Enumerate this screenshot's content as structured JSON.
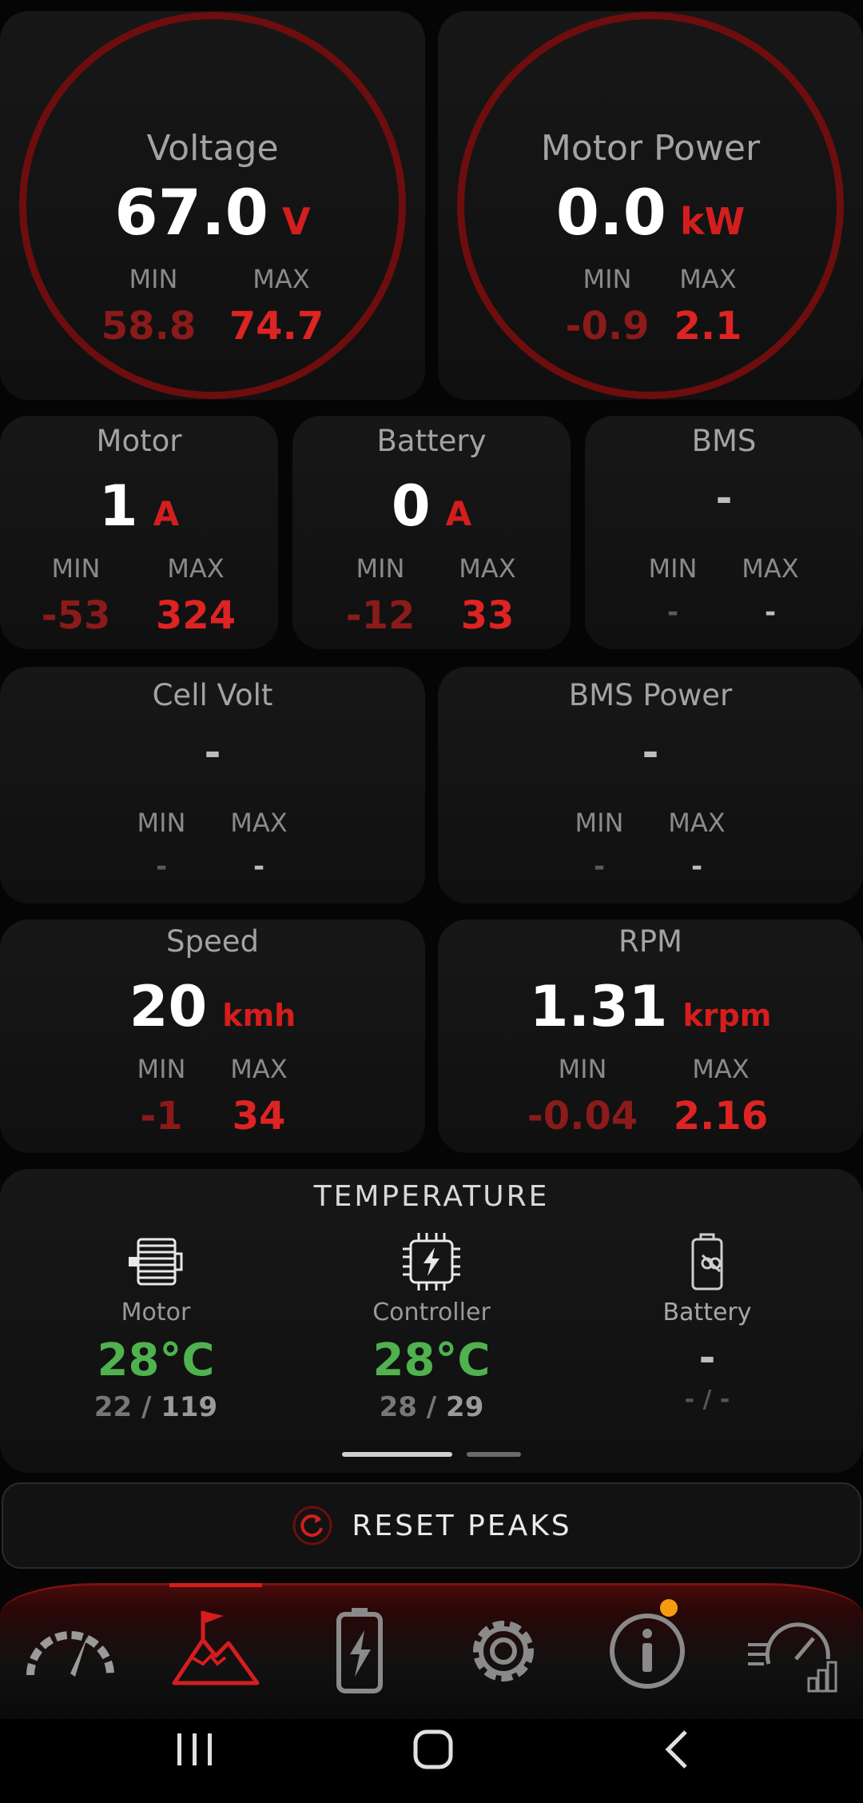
{
  "voltage": {
    "title": "Voltage",
    "value": "67.0",
    "unit": "V",
    "min_label": "MIN",
    "max_label": "MAX",
    "min": "58.8",
    "max": "74.7"
  },
  "motor_power": {
    "title": "Motor Power",
    "value": "0.0",
    "unit": "kW",
    "min_label": "MIN",
    "max_label": "MAX",
    "min": "-0.9",
    "max": "2.1"
  },
  "motor": {
    "title": "Motor",
    "value": "1",
    "unit": "A",
    "min_label": "MIN",
    "max_label": "MAX",
    "min": "-53",
    "max": "324"
  },
  "battery": {
    "title": "Battery",
    "value": "0",
    "unit": "A",
    "min_label": "MIN",
    "max_label": "MAX",
    "min": "-12",
    "max": "33"
  },
  "bms": {
    "title": "BMS",
    "value": "-",
    "min_label": "MIN",
    "max_label": "MAX",
    "min": "-",
    "max": "-"
  },
  "cell_volt": {
    "title": "Cell Volt",
    "value": "-",
    "min_label": "MIN",
    "max_label": "MAX",
    "min": "-",
    "max": "-"
  },
  "bms_power": {
    "title": "BMS Power",
    "value": "-",
    "min_label": "MIN",
    "max_label": "MAX",
    "min": "-",
    "max": "-"
  },
  "speed": {
    "title": "Speed",
    "value": "20",
    "unit": "kmh",
    "min_label": "MIN",
    "max_label": "MAX",
    "min": "-1",
    "max": "34"
  },
  "rpm": {
    "title": "RPM",
    "value": "1.31",
    "unit": "krpm",
    "min_label": "MIN",
    "max_label": "MAX",
    "min": "-0.04",
    "max": "2.16"
  },
  "temperature": {
    "title": "TEMPERATURE",
    "motor": {
      "label": "Motor",
      "value": "28°C",
      "min": "22",
      "sep": " / ",
      "max": "119",
      "icon": "motor-icon"
    },
    "controller": {
      "label": "Controller",
      "value": "28°C",
      "min": "28",
      "sep": " / ",
      "max": "29",
      "icon": "chip-bolt-icon"
    },
    "battery": {
      "label": "Battery",
      "value": "-",
      "minmax": "- / -",
      "icon": "battery-unlinked-icon"
    }
  },
  "reset": {
    "label": "RESET PEAKS",
    "icon": "reset-icon"
  },
  "nav": {
    "items": [
      "speedometer-icon",
      "mountain-flag-icon",
      "battery-bolt-icon",
      "gear-icon",
      "info-icon",
      "speed-stats-icon"
    ],
    "active_index": 1,
    "badge_color": "#f59b12"
  },
  "colors": {
    "accent": "#d41e1e",
    "ring": "#6d0d0d",
    "temp_ok": "#4fb24f",
    "background": "#050505"
  }
}
